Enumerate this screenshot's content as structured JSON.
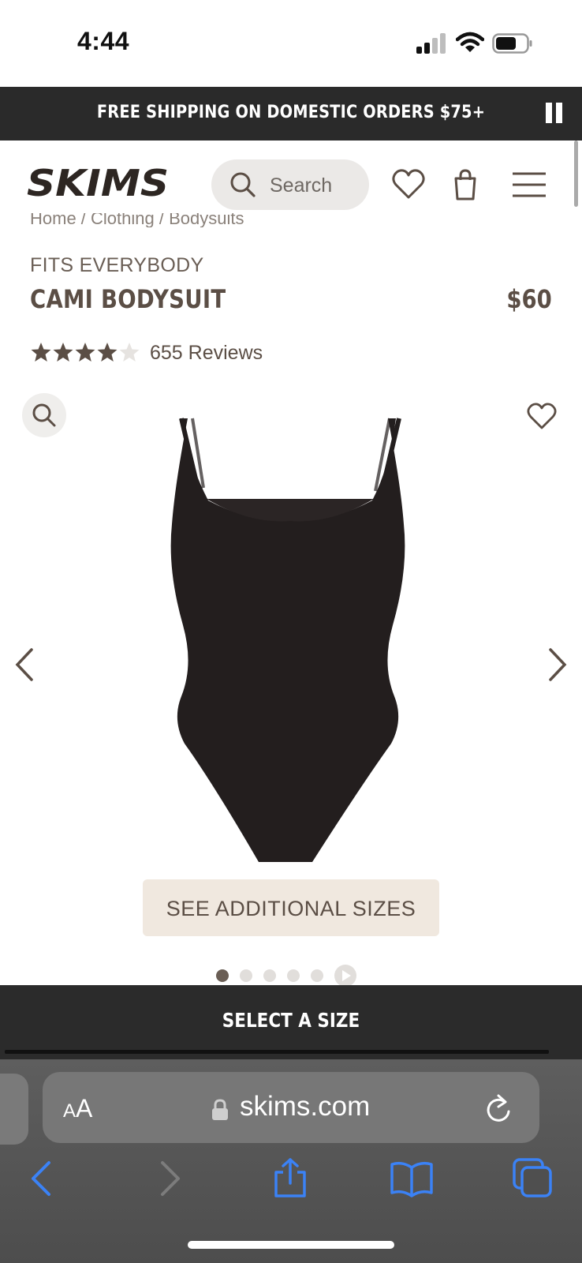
{
  "status_bar": {
    "time": "4:44"
  },
  "promo": {
    "text": "FREE SHIPPING ON DOMESTIC ORDERS $75+"
  },
  "header": {
    "logo": "SKIMS",
    "search_placeholder": "Search"
  },
  "breadcrumb": {
    "text": "Home / Clothing / Bodysuits"
  },
  "product": {
    "collection": "FITS EVERYBODY",
    "name": "CAMI BODYSUIT",
    "price": "$60",
    "rating": 4.5,
    "rating_max": 5,
    "reviews": "655 Reviews",
    "color": "#231e1e"
  },
  "gallery": {
    "sizes_button": "SEE ADDITIONAL SIZES",
    "slide_count": 5,
    "active_slide": 1
  },
  "cta": {
    "select_size": "SELECT A SIZE"
  },
  "browser": {
    "text_size": "AA",
    "url": "skims.com"
  },
  "colors": {
    "accent": "#5b4e45",
    "dark": "#2a2a2a",
    "safari_blue": "#3b82f6",
    "sizes_bg": "#f0e8df"
  }
}
